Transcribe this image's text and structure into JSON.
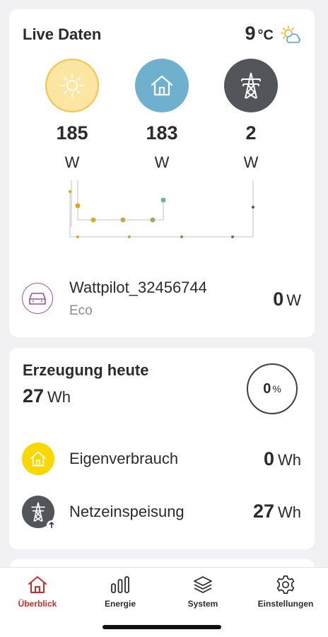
{
  "live": {
    "title": "Live Daten",
    "temperature": "9",
    "temperature_unit": "°C",
    "weather_icon": "partly-sunny-icon",
    "pv": {
      "icon": "sun-icon",
      "value": "185",
      "unit": "W",
      "color": "#fde5a2"
    },
    "home": {
      "icon": "house-icon",
      "value": "183",
      "unit": "W",
      "color": "#6fb0cf"
    },
    "grid": {
      "icon": "power-pylon-icon",
      "value": "2",
      "unit": "W",
      "color": "#52555a"
    },
    "wattpilot": {
      "name": "Wattpilot_32456744",
      "mode": "Eco",
      "value": "0",
      "unit": "W",
      "icon": "car-icon"
    }
  },
  "production": {
    "title": "Erzeugung heute",
    "total_value": "27",
    "total_unit": "Wh",
    "percent_value": "0",
    "percent_unit": "%",
    "rows": [
      {
        "label": "Eigenverbrauch",
        "value": "0",
        "unit": "Wh",
        "icon": "house-icon",
        "color": "#f9d800"
      },
      {
        "label": "Netzeinspeisung",
        "value": "27",
        "unit": "Wh",
        "icon": "power-pylon-icon",
        "color": "#52555a"
      }
    ]
  },
  "nav": {
    "items": [
      {
        "label": "Überblick",
        "icon": "house-icon",
        "active": true
      },
      {
        "label": "Energie",
        "icon": "bar-chart-icon",
        "active": false
      },
      {
        "label": "System",
        "icon": "layers-icon",
        "active": false
      },
      {
        "label": "Einstellungen",
        "icon": "gear-icon",
        "active": false
      }
    ],
    "active_color": "#d22a2a"
  }
}
